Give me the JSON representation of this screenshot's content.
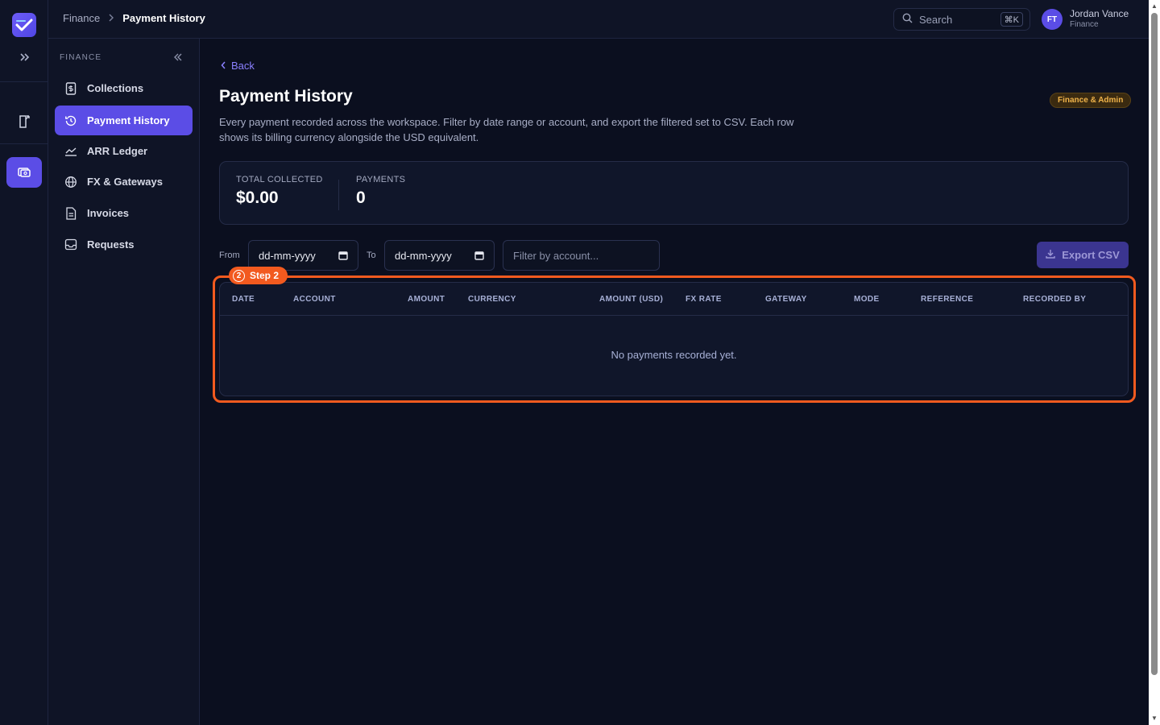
{
  "topbar": {
    "breadcrumb": [
      "Finance",
      "Payment History"
    ],
    "search_label": "Search",
    "search_shortcut": "⌘K",
    "user": {
      "initials": "FT",
      "name": "Jordan Vance",
      "role": "Finance"
    }
  },
  "sidebar": {
    "section_title": "FINANCE",
    "items": [
      {
        "label": "Collections",
        "icon": "dollar-file-icon",
        "active": false
      },
      {
        "label": "Payment History",
        "icon": "history-icon",
        "active": true
      },
      {
        "label": "ARR Ledger",
        "icon": "chart-line-icon",
        "active": false
      },
      {
        "label": "FX & Gateways",
        "icon": "globe-icon",
        "active": false
      },
      {
        "label": "Invoices",
        "icon": "document-icon",
        "active": false
      },
      {
        "label": "Requests",
        "icon": "inbox-icon",
        "active": false
      }
    ]
  },
  "main": {
    "back_label": "Back",
    "title": "Payment History",
    "badge": "Finance & Admin",
    "description": "Every payment recorded across the workspace. Filter by date range or account, and export the filtered set to CSV. Each row shows its billing currency alongside the USD equivalent.",
    "stats": [
      {
        "label": "TOTAL COLLECTED",
        "value": "$0.00"
      },
      {
        "label": "PAYMENTS",
        "value": "0"
      }
    ],
    "filters": {
      "from_label": "From",
      "from_value": "dd-mm-yyyy",
      "to_label": "To",
      "to_value": "dd-mm-yyyy",
      "account_placeholder": "Filter by account...",
      "export_label": "Export CSV"
    },
    "step_badge": {
      "number": "2",
      "label": "Step 2"
    },
    "table": {
      "columns": [
        "DATE",
        "ACCOUNT",
        "AMOUNT",
        "CURRENCY",
        "AMOUNT (USD)",
        "FX RATE",
        "GATEWAY",
        "MODE",
        "REFERENCE",
        "RECORDED BY"
      ],
      "empty_message": "No payments recorded yet."
    }
  },
  "colors": {
    "accent": "#5b4de6",
    "highlight": "#f25a1f",
    "badge_text": "#f0b34a"
  }
}
